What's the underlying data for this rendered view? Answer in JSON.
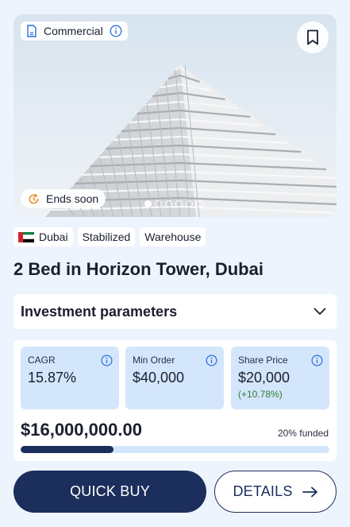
{
  "hero": {
    "type_label": "Commercial",
    "type_icon": "building-doc-icon",
    "info_icon": "info-icon",
    "ends_label": "Ends soon",
    "ends_icon": "clock-refresh-icon",
    "bookmark_icon": "bookmark-icon",
    "carousel": {
      "count": 6,
      "active": 1
    }
  },
  "tags": [
    {
      "label": "Dubai",
      "icon": "uae-flag-icon"
    },
    {
      "label": "Stabilized"
    },
    {
      "label": "Warehouse"
    }
  ],
  "title": "2 Bed in Horizon Tower, Dubai",
  "accordion": {
    "label": "Investment parameters",
    "icon": "chevron-down-icon"
  },
  "metrics": [
    {
      "label": "CAGR",
      "value": "15.87%",
      "sub": ""
    },
    {
      "label": "Min Order",
      "value": "$40,000",
      "sub": ""
    },
    {
      "label": "Share Price",
      "value": "$20,000",
      "sub": "(+10.78%)"
    }
  ],
  "funding": {
    "total": "$16,000,000.00",
    "funded_text": "20% funded",
    "funded_fraction": 0.3
  },
  "buttons": {
    "quick_buy": "QUICK BUY",
    "details": "DETAILS",
    "details_icon": "arrow-right-icon"
  },
  "colors": {
    "primary": "#1c2e5c",
    "metric_bg": "#d3e6fb",
    "positive": "#2e7d32",
    "page_bg": "#eef4fd"
  }
}
